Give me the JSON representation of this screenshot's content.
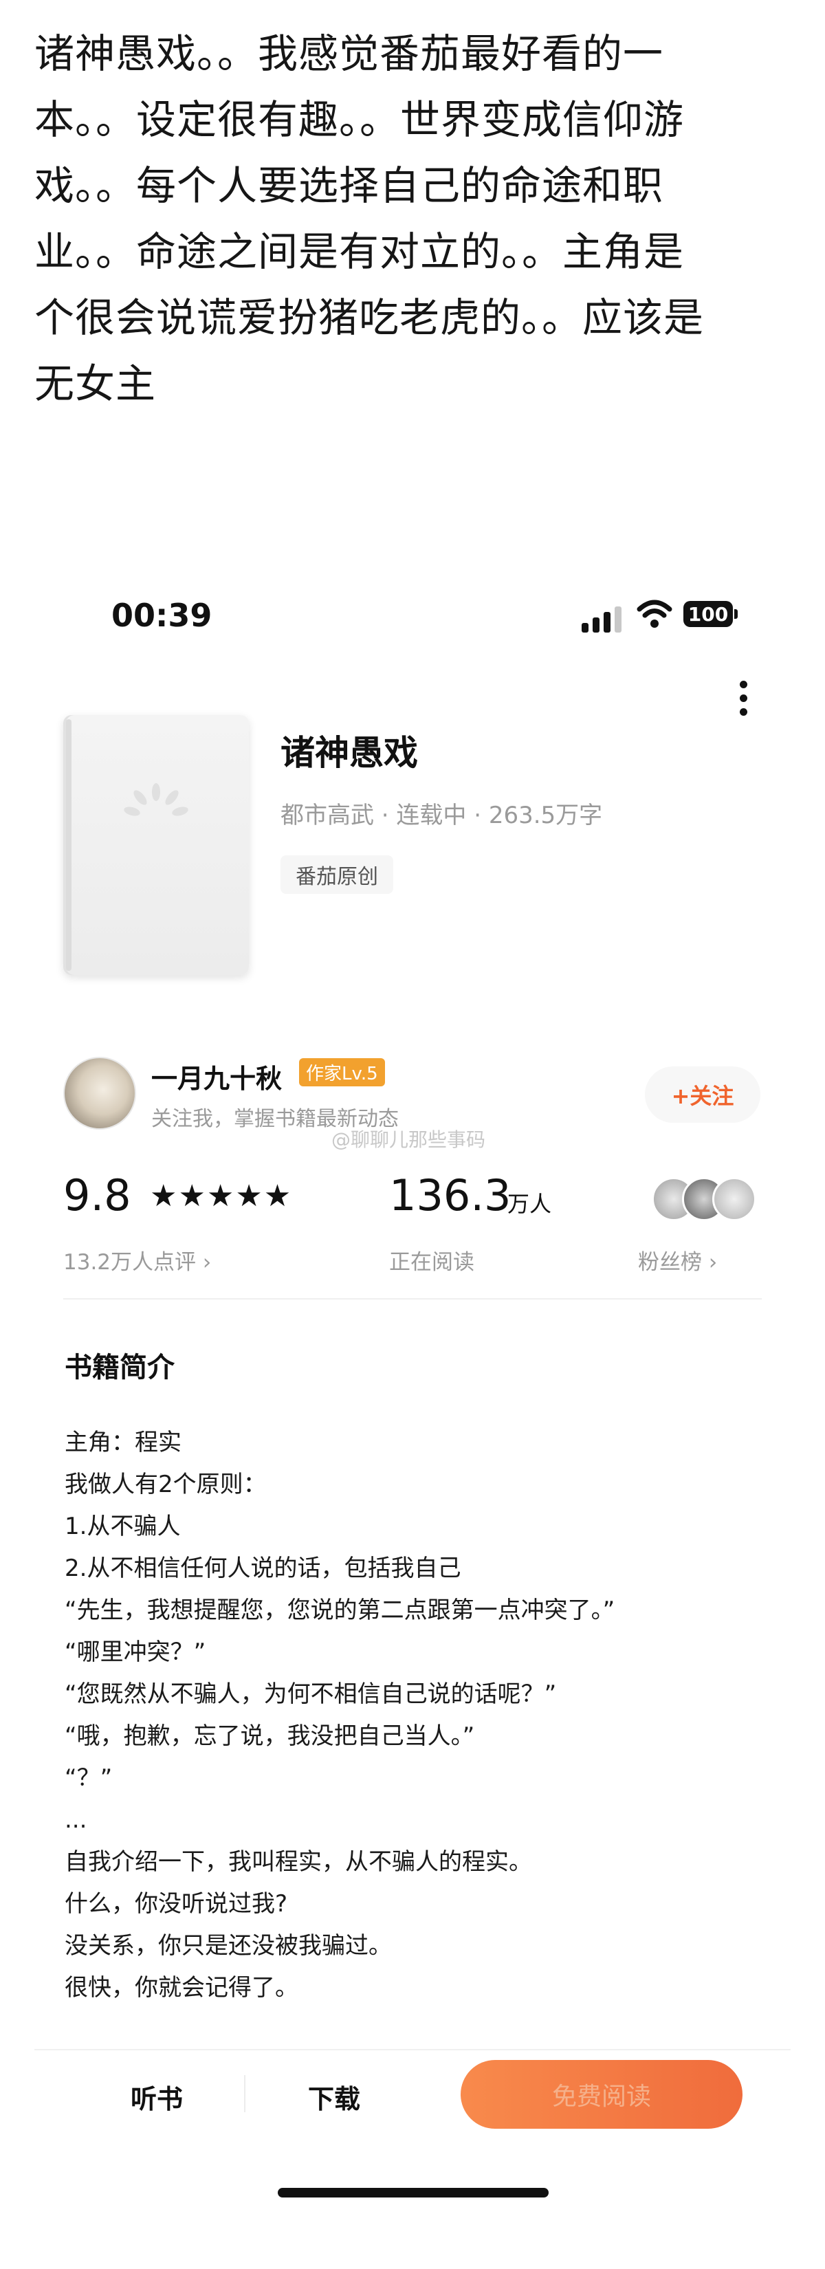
{
  "post": {
    "lines": [
      "诸神愚戏。。我感觉番茄最好看的一",
      "本。。设定很有趣。。世界变成信仰游",
      "戏。。每个人要选择自己的命途和职",
      "业。。命途之间是有对立的。。主角是",
      "个很会说谎爱扮猪吃老虎的。。应该是",
      "无女主"
    ]
  },
  "status_bar": {
    "time": "00:39",
    "battery": "100"
  },
  "book": {
    "title": "诸神愚戏",
    "meta": "都市高武 · 连载中 · 263.5万字",
    "tag": "番茄原创"
  },
  "author": {
    "name": "一月九十秋",
    "level": "作家Lv.5",
    "desc": "关注我，掌握书籍最新动态",
    "follow_label": "+关注"
  },
  "watermark": "@聊聊儿那些事码",
  "stats": {
    "rating": "9.8",
    "stars": "★★★★★",
    "rating_count": "13.2万人点评 ›",
    "readers": "136.3",
    "readers_unit": "万人",
    "readers_label": "正在阅读",
    "fans_label": "粉丝榜 ›"
  },
  "intro": {
    "title": "书籍简介",
    "lines": [
      "主角：程实",
      "我做人有2个原则：",
      "1.从不骗人",
      "2.从不相信任何人说的话，包括我自己",
      "“先生，我想提醒您，您说的第二点跟第一点冲突了。”",
      "“哪里冲突？”",
      "“您既然从不骗人，为何不相信自己说的话呢？”",
      "“哦，抱歉，忘了说，我没把自己当人。”",
      "“？”",
      "...",
      "自我介绍一下，我叫程实，从不骗人的程实。",
      "什么，你没听说过我?",
      "没关系，你只是还没被我骗过。",
      "很快，你就会记得了。"
    ]
  },
  "bottom_bar": {
    "listen_label": "听书",
    "download_label": "下载",
    "read_label": "免费阅读"
  },
  "colors": {
    "accent_orange": "#f06c3c",
    "level_badge": "#f2a12e"
  }
}
